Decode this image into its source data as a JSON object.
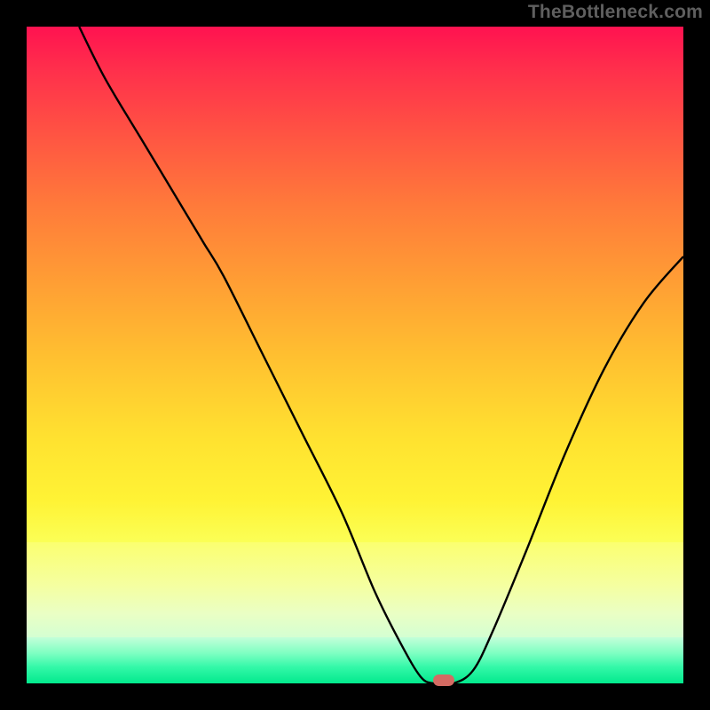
{
  "watermark": "TheBottleneck.com",
  "colors": {
    "frame": "#000000",
    "watermark": "#5f5f5f",
    "curve": "#000000",
    "marker": "#d46b63",
    "gradient_top": "#ff1250",
    "gradient_middle": "#fff335",
    "gradient_bottom": "#02e98d"
  },
  "chart_data": {
    "type": "line",
    "title": "",
    "xlabel": "",
    "ylabel": "",
    "xlim": [
      0,
      100
    ],
    "ylim": [
      0,
      100
    ],
    "legend": [],
    "annotations": [],
    "series": [
      {
        "name": "bottleneck-curve",
        "x": [
          8,
          12,
          18,
          24,
          27,
          30,
          36,
          42,
          48,
          53,
          57,
          60,
          62,
          65,
          68,
          71,
          76,
          82,
          88,
          94,
          100
        ],
        "y": [
          100,
          92,
          82,
          72,
          67,
          62,
          50,
          38,
          26,
          14,
          6,
          1,
          0,
          0,
          2,
          8,
          20,
          35,
          48,
          58,
          65
        ]
      }
    ],
    "marker": {
      "x": 63.5,
      "y": 0
    }
  }
}
